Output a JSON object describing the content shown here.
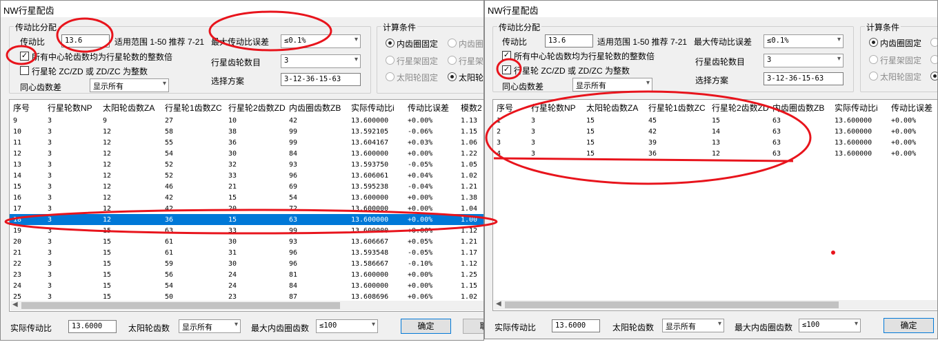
{
  "left": {
    "title": "NW行星配齿",
    "ratio_group": {
      "title": "传动比分配",
      "ratio_label": "传动比",
      "ratio_value": "13.6",
      "range_text": "适用范围 1-50 推荐 7-21",
      "max_error_label": "最大传动比误差",
      "max_error_value": "≤0.1%",
      "chk_multiple": "所有中心轮齿数均为行星轮数的整数倍",
      "chk_multiple_checked": true,
      "chk_integer": "行星轮 ZC/ZD 或 ZD/ZC 为整数",
      "chk_integer_checked": false,
      "planet_count_label": "行星齿轮数目",
      "planet_count_value": "3",
      "concentric_label": "同心齿数差",
      "concentric_value": "显示所有",
      "scheme_label": "选择方案",
      "scheme_value": "3-12-36-15-63"
    },
    "calc_group": {
      "title": "计算条件",
      "opts": [
        "内齿圈固定",
        "内齿圈",
        "行星架固定",
        "行星架",
        "太阳轮固定",
        "太阳轮"
      ]
    },
    "table": {
      "headers": [
        "序号",
        "行星轮数NP",
        "太阳轮齿数ZA",
        "行星轮1齿数ZC",
        "行星轮2齿数ZD",
        "内齿圈齿数ZB",
        "实际传动比i",
        "传动比误差",
        "模数2"
      ],
      "rows": [
        [
          "9",
          "3",
          "9",
          "27",
          "10",
          "42",
          "13.600000",
          "+0.00%",
          "1.13"
        ],
        [
          "10",
          "3",
          "12",
          "58",
          "38",
          "99",
          "13.592105",
          "-0.06%",
          "1.15"
        ],
        [
          "11",
          "3",
          "12",
          "55",
          "36",
          "99",
          "13.604167",
          "+0.03%",
          "1.06"
        ],
        [
          "12",
          "3",
          "12",
          "54",
          "30",
          "84",
          "13.600000",
          "+0.00%",
          "1.22"
        ],
        [
          "13",
          "3",
          "12",
          "52",
          "32",
          "93",
          "13.593750",
          "-0.05%",
          "1.05"
        ],
        [
          "14",
          "3",
          "12",
          "52",
          "33",
          "96",
          "13.606061",
          "+0.04%",
          "1.02"
        ],
        [
          "15",
          "3",
          "12",
          "46",
          "21",
          "69",
          "13.595238",
          "-0.04%",
          "1.21"
        ],
        [
          "16",
          "3",
          "12",
          "42",
          "15",
          "54",
          "13.600000",
          "+0.00%",
          "1.38"
        ],
        [
          "17",
          "3",
          "12",
          "42",
          "20",
          "72",
          "13.600000",
          "+0.00%",
          "1.04"
        ],
        [
          "18",
          "3",
          "12",
          "36",
          "15",
          "63",
          "13.600000",
          "+0.00%",
          "1.00"
        ],
        [
          "19",
          "3",
          "15",
          "63",
          "33",
          "99",
          "13.600000",
          "+0.00%",
          "1.12"
        ],
        [
          "20",
          "3",
          "15",
          "61",
          "30",
          "93",
          "13.606667",
          "+0.05%",
          "1.21"
        ],
        [
          "21",
          "3",
          "15",
          "61",
          "31",
          "96",
          "13.593548",
          "-0.05%",
          "1.17"
        ],
        [
          "22",
          "3",
          "15",
          "59",
          "30",
          "96",
          "13.586667",
          "-0.10%",
          "1.12"
        ],
        [
          "23",
          "3",
          "15",
          "56",
          "24",
          "81",
          "13.600000",
          "+0.00%",
          "1.25"
        ],
        [
          "24",
          "3",
          "15",
          "54",
          "24",
          "84",
          "13.600000",
          "+0.00%",
          "1.15"
        ],
        [
          "25",
          "3",
          "15",
          "50",
          "23",
          "87",
          "13.608696",
          "+0.06%",
          "1.02"
        ]
      ],
      "selected_row": "18"
    },
    "bottom": {
      "actual_label": "实际传动比",
      "actual_value": "13.6000",
      "sun_label": "太阳轮齿数",
      "sun_value": "显示所有",
      "max_ring_label": "最大内齿圈齿数",
      "max_ring_value": "≤100",
      "ok": "确定",
      "cancel": "取消"
    }
  },
  "right": {
    "title": "NW行星配齿",
    "ratio_group": {
      "title": "传动比分配",
      "ratio_label": "传动比",
      "ratio_value": "13.6",
      "range_text": "适用范围 1-50 推荐 7-21",
      "max_error_label": "最大传动比误差",
      "max_error_value": "≤0.1%",
      "chk_multiple": "所有中心轮齿数均为行星轮数的整数倍",
      "chk_multiple_checked": true,
      "chk_integer": "行星轮 ZC/ZD 或 ZD/ZC 为整数",
      "chk_integer_checked": true,
      "planet_count_label": "行星齿轮数目",
      "planet_count_value": "3",
      "concentric_label": "同心齿数差",
      "concentric_value": "显示所有",
      "scheme_label": "选择方案",
      "scheme_value": "3-12-36-15-63"
    },
    "calc_group": {
      "title": "计算条件",
      "opts": [
        "内齿圈固定",
        "行星架固定",
        "太阳轮固定"
      ]
    },
    "table": {
      "headers": [
        "序号",
        "行星轮数NP",
        "太阳轮齿数ZA",
        "行星轮1齿数ZC",
        "行星轮2齿数ZD",
        "内齿圈齿数ZB",
        "实际传动比i",
        "传动比误差"
      ],
      "rows": [
        [
          "1",
          "3",
          "15",
          "45",
          "15",
          "63",
          "13.600000",
          "+0.00%"
        ],
        [
          "2",
          "3",
          "15",
          "42",
          "14",
          "63",
          "13.600000",
          "+0.00%"
        ],
        [
          "3",
          "3",
          "15",
          "39",
          "13",
          "63",
          "13.600000",
          "+0.00%"
        ],
        [
          "4",
          "3",
          "15",
          "36",
          "12",
          "63",
          "13.600000",
          "+0.00%"
        ]
      ]
    },
    "bottom": {
      "actual_label": "实际传动比",
      "actual_value": "13.6000",
      "sun_label": "太阳轮齿数",
      "sun_value": "显示所有",
      "max_ring_label": "最大内齿圈齿数",
      "max_ring_value": "≤100",
      "ok": "确定"
    }
  },
  "colors": {
    "annotation": "#e8141c",
    "selection": "#0078d7",
    "dialog_bg": "#f0f0f0"
  }
}
